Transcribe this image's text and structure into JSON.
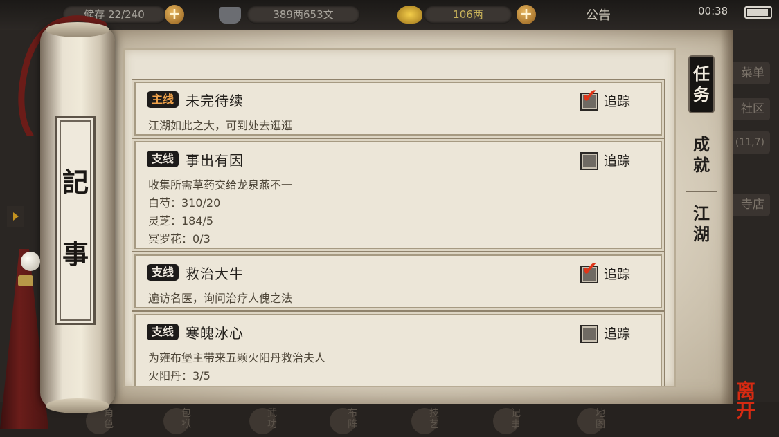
{
  "hud": {
    "bag_label": "储存",
    "bag_value": "22/240",
    "silver": "389两653文",
    "gold": "106两",
    "notice": "公告",
    "time": "00:38"
  },
  "book": {
    "title_char_1": "記",
    "title_char_2": "事"
  },
  "tabs": [
    {
      "label": "任务",
      "active": true
    },
    {
      "label": "成就",
      "active": false
    },
    {
      "label": "江湖",
      "active": false
    }
  ],
  "track_label": "追踪",
  "quests": [
    {
      "type": "主线",
      "title": "未完待续",
      "lines": [
        "江湖如此之大，可到处去逛逛"
      ],
      "tracked": true
    },
    {
      "type": "支线",
      "title": "事出有因",
      "lines": [
        "收集所需草药交给龙泉燕不一",
        "白芍：310/20",
        "灵芝：184/5",
        "冥罗花：0/3"
      ],
      "tracked": false
    },
    {
      "type": "支线",
      "title": "救治大牛",
      "lines": [
        "遍访名医，询问治疗人傀之法"
      ],
      "tracked": true
    },
    {
      "type": "支线",
      "title": "寒魄冰心",
      "lines": [
        "为雍布堡主带来五颗火阳丹救治夫人",
        "火阳丹：3/5"
      ],
      "tracked": false
    }
  ],
  "side_menu": [
    "菜单",
    "社区",
    "(11,7)",
    "寺店"
  ],
  "bottom_bar": [
    "角色",
    "包袱",
    "武功",
    "布阵",
    "技艺",
    "记事",
    "地图"
  ],
  "leave_label": "离开"
}
